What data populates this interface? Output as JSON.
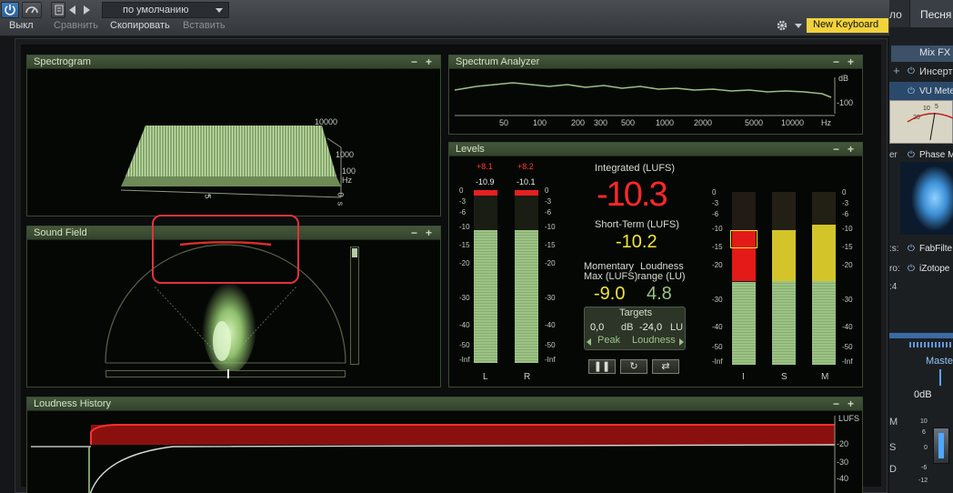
{
  "toolbar": {
    "power_label": "Выкл",
    "compare_label": "Сравнить",
    "copy_label": "Скопировать",
    "paste_label": "Вставить",
    "preset_value": "по умолчанию",
    "keyboard_label": "New Keyboard"
  },
  "right_strip": {
    "tab_partial": "ло",
    "tab_song": "Песня",
    "mix_fx": "Mix FX",
    "insert": "Инсерт",
    "vu_meter": "VU Mete",
    "phase": "Phase M",
    "fabfilter": "FabFilte",
    "izotope": "iZotope",
    "master": "Master",
    "fader_db": "0dB",
    "vu_scale": [
      "20",
      "10",
      "5"
    ],
    "fader_scale": [
      "10",
      "6",
      "0",
      "-6",
      "-12"
    ],
    "row_marks": [
      "er",
      ":s:",
      "ro:",
      ":4"
    ],
    "edge_marks": [
      "M",
      "S",
      "D"
    ]
  },
  "spectrogram": {
    "title": "Spectrogram",
    "freq_labels": [
      "10000",
      "1000",
      "100",
      "Hz"
    ],
    "time_labels": [
      "5",
      "0",
      "s"
    ]
  },
  "analyzer": {
    "title": "Spectrum Analyzer",
    "unit": "dB",
    "db_label": "-100",
    "freqs": [
      "50",
      "100",
      "200",
      "300",
      "500",
      "1000",
      "2000",
      "5000",
      "10000",
      "Hz"
    ]
  },
  "soundfield": {
    "title": "Sound Field"
  },
  "levels": {
    "title": "Levels",
    "peak_L": "+8.1",
    "peak_R": "+8.2",
    "rms_L": "-10.9",
    "rms_R": "-10.1",
    "level_L": 0.77,
    "level_R": 0.77,
    "scale": [
      "0",
      "-3",
      "-6",
      "-10",
      "-15",
      "-20",
      "-30",
      "-40",
      "-50",
      "-Inf"
    ],
    "ch_L": "L",
    "ch_R": "R",
    "integrated_label": "Integrated (LUFS)",
    "integrated_value": "-10.3",
    "shortterm_label": "Short-Term (LUFS)",
    "shortterm_value": "-10.2",
    "momentary_label1": "Momentary",
    "momentary_label2": "Max (LUFS)",
    "momentary_value": "-9.0",
    "range_label1": "Loudness",
    "range_label2": "range (LU)",
    "range_value": "4.8",
    "targets_label": "Targets",
    "target_peak_value": "0,0",
    "target_peak_unit": "dB",
    "target_loud_value": "-24,0",
    "target_loud_unit": "LU",
    "peak_label": "Peak",
    "loudness_label": "Loudness",
    "ch_I": "I",
    "ch_S": "S",
    "ch_M": "M",
    "level_I": 0.48,
    "level_S": 0.77,
    "level_M": 0.8
  },
  "history": {
    "title": "Loudness History",
    "unit": "LUFS",
    "scale": [
      "-20",
      "-30",
      "-40"
    ]
  },
  "colors": {
    "accent_red": "#e62020",
    "accent_yellow": "#e9e23a",
    "panel_green": "#3b4a33",
    "keyboard_bg": "#f2d23c"
  }
}
